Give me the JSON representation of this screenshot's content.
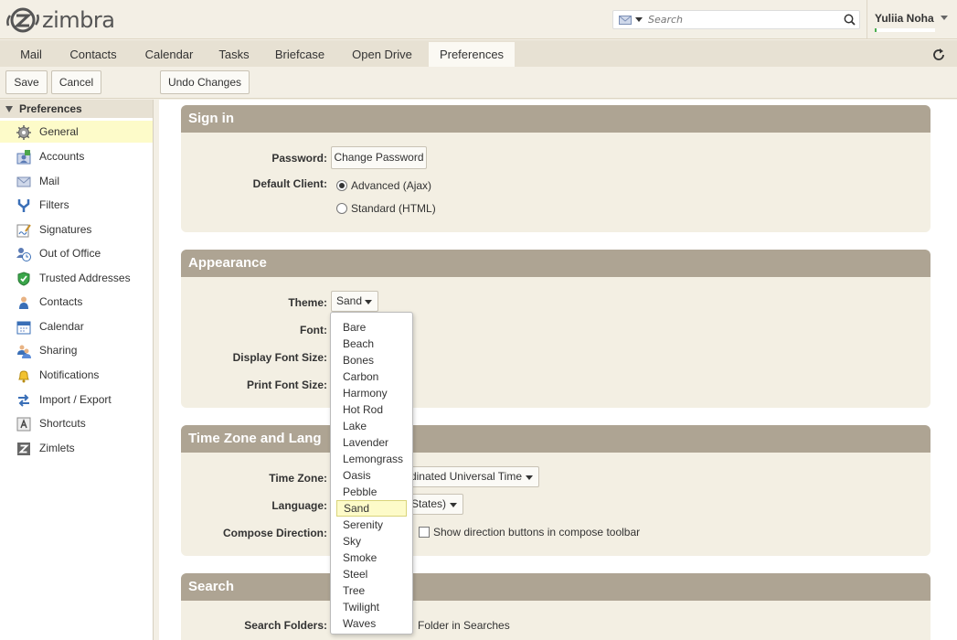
{
  "app": {
    "logo_text": "zimbra"
  },
  "search": {
    "placeholder": "Search"
  },
  "user": {
    "name": "Yuliia Noha"
  },
  "tabs": [
    "Mail",
    "Contacts",
    "Calendar",
    "Tasks",
    "Briefcase",
    "Open Drive",
    "Preferences"
  ],
  "toolbar": {
    "save": "Save",
    "cancel": "Cancel",
    "undo": "Undo Changes"
  },
  "sidebar": {
    "title": "Preferences",
    "items": [
      "General",
      "Accounts",
      "Mail",
      "Filters",
      "Signatures",
      "Out of Office",
      "Trusted Addresses",
      "Contacts",
      "Calendar",
      "Sharing",
      "Notifications",
      "Import / Export",
      "Shortcuts",
      "Zimlets"
    ]
  },
  "signin": {
    "title": "Sign in",
    "password_label": "Password:",
    "change_password": "Change Password",
    "default_client_label": "Default Client:",
    "client_advanced": "Advanced (Ajax)",
    "client_standard": "Standard (HTML)"
  },
  "appearance": {
    "title": "Appearance",
    "theme_label": "Theme:",
    "theme_value": "Sand",
    "font_label": "Font:",
    "display_font_label": "Display Font Size:",
    "print_font_label": "Print Font Size:"
  },
  "timezone": {
    "title": "Time Zone and Lang",
    "tz_label": "Time Zone:",
    "tz_value": "dinated Universal Time",
    "lang_label": "Language:",
    "lang_value": "States)",
    "compose_label": "Compose Direction:",
    "compose_value": "Show direction buttons in compose toolbar"
  },
  "search_section": {
    "title": "Search",
    "folders_label": "Search Folders:",
    "folders_value": "Folder in Searches"
  },
  "theme_options": [
    "Bare",
    "Beach",
    "Bones",
    "Carbon",
    "Harmony",
    "Hot Rod",
    "Lake",
    "Lavender",
    "Lemongrass",
    "Oasis",
    "Pebble",
    "Sand",
    "Serenity",
    "Sky",
    "Smoke",
    "Steel",
    "Tree",
    "Twilight",
    "Waves"
  ],
  "theme_selected": "Sand"
}
